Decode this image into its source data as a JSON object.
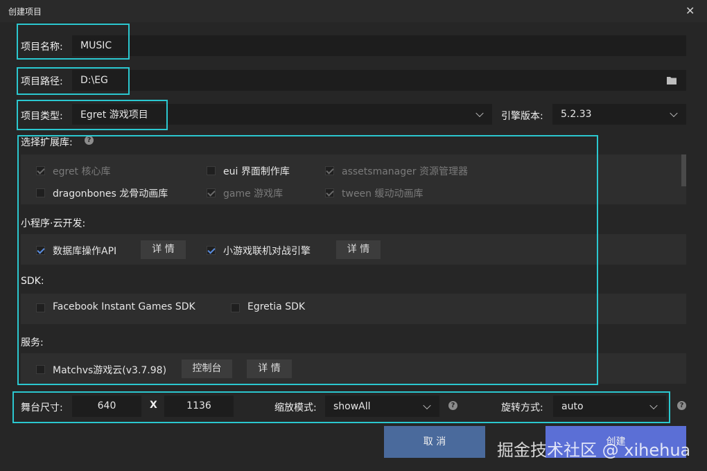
{
  "window": {
    "title": "创建项目"
  },
  "form": {
    "name_label": "项目名称:",
    "name_value": "MUSIC",
    "path_label": "项目路径:",
    "path_value": "D:\\EG",
    "type_label": "项目类型:",
    "type_value": "Egret 游戏项目",
    "engine_label": "引擎版本:",
    "engine_value": "5.2.33"
  },
  "ext": {
    "title": "选择扩展库:",
    "items": [
      {
        "label": "egret 核心库",
        "checked": true,
        "disabled": true
      },
      {
        "label": "eui 界面制作库",
        "checked": false,
        "disabled": false
      },
      {
        "label": "assetsmanager 资源管理器",
        "checked": true,
        "disabled": true
      },
      {
        "label": "dragonbones 龙骨动画库",
        "checked": false,
        "disabled": false
      },
      {
        "label": "game 游戏库",
        "checked": true,
        "disabled": true
      },
      {
        "label": "tween 缓动动画库",
        "checked": true,
        "disabled": true
      }
    ]
  },
  "mini": {
    "title": "小程序·云开发:",
    "items": [
      {
        "label": "数据库操作API",
        "checked": true,
        "button": "详 情"
      },
      {
        "label": "小游戏联机对战引擎",
        "checked": true,
        "button": "详 情"
      }
    ]
  },
  "sdk": {
    "title": "SDK:",
    "items": [
      {
        "label": "Facebook Instant Games SDK",
        "checked": false
      },
      {
        "label": "Egretia SDK",
        "checked": false
      }
    ]
  },
  "service": {
    "title": "服务:",
    "item": {
      "label": "Matchvs游戏云(v3.7.98)",
      "checked": false
    },
    "console_button": "控制台",
    "detail_button": "详 情"
  },
  "stage": {
    "size_label": "舞台尺寸:",
    "width": "640",
    "x_label": "X",
    "height": "1136",
    "scale_label": "缩放模式:",
    "scale_value": "showAll",
    "rotate_label": "旋转方式:",
    "rotate_value": "auto"
  },
  "buttons": {
    "cancel": "取 消",
    "create": "创建"
  },
  "watermark": "掘金技术社区 @ xihehua",
  "colors": {
    "highlight": "#2bc8d0",
    "checkbox_tick": "#5a8de0",
    "cancel_bg": "#4a6a9c",
    "create_bg": "#5b6fd6"
  }
}
